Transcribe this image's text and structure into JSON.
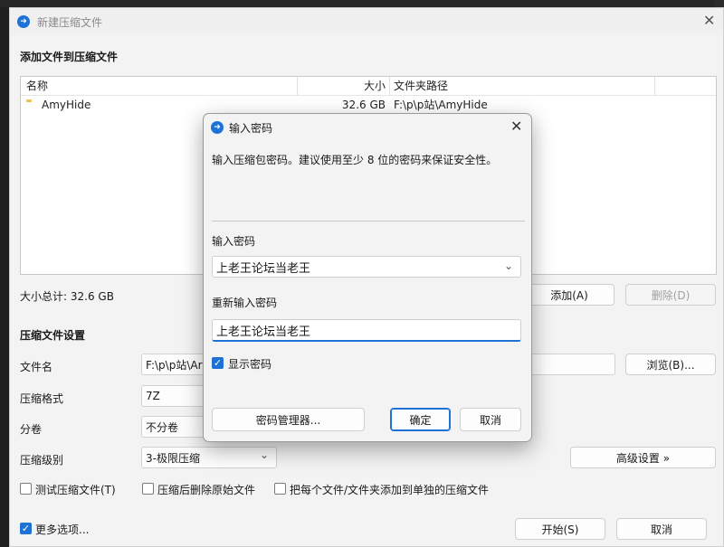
{
  "window": {
    "title": "新建压缩文件"
  },
  "add_section": {
    "title": "添加文件到压缩文件"
  },
  "filelist": {
    "columns": {
      "name": "名称",
      "size": "大小",
      "path": "文件夹路径"
    },
    "rows": [
      {
        "name": "AmyHide",
        "size": "32.6 GB",
        "path": "F:\\p\\p站\\AmyHide"
      }
    ]
  },
  "total": "大小总计: 32.6 GB",
  "buttons": {
    "add": "添加(A)",
    "delete": "删除(D)",
    "browse": "浏览(B)...",
    "advanced": "高级设置 »",
    "start": "开始(S)",
    "cancel": "取消"
  },
  "settings": {
    "title": "压缩文件设置",
    "filename_label": "文件名",
    "filename_value": "F:\\p\\p站\\Ar",
    "format_label": "压缩格式",
    "format_value": "7Z",
    "volume_label": "分卷",
    "volume_value": "不分卷",
    "level_label": "压缩级别",
    "level_value": "3-极限压缩"
  },
  "options": {
    "test": "测试压缩文件(T)",
    "delete_after": "压缩后删除原始文件",
    "each_separate": "把每个文件/文件夹添加到单独的压缩文件",
    "more": "更多选项..."
  },
  "dialog": {
    "title": "输入密码",
    "hint": "输入压缩包密码。建议使用至少 8 位的密码来保证安全性。",
    "pwd_label": "输入密码",
    "pwd_value": "上老王论坛当老王",
    "repwd_label": "重新输入密码",
    "repwd_value": "上老王论坛当老王",
    "show_pwd": "显示密码",
    "manager": "密码管理器...",
    "ok": "确定",
    "cancel": "取消"
  },
  "colors": {
    "accent": "#1e72d6",
    "folder": "#f2c14e"
  }
}
